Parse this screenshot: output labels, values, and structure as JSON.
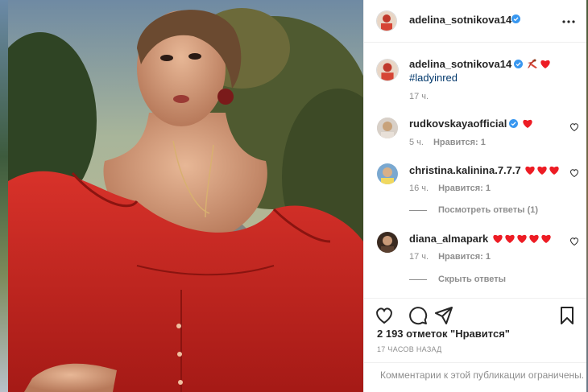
{
  "post": {
    "author": "adelina_sotnikova14",
    "caption_author": "adelina_sotnikova14",
    "caption_hashtag": "#ladyinred",
    "caption_time": "17 ч.",
    "likes_text": "2 193 отметок \"Нравится\"",
    "time_ago": "17 ЧАСОВ НАЗАД",
    "comments_limited": "Комментарии к этой публикации ограничены."
  },
  "comments": [
    {
      "user": "rudkovskayaofficial",
      "hearts": 1,
      "time": "5 ч.",
      "likes": "Нравится: 1"
    },
    {
      "user": "christina.kalinina.7.7.7",
      "hearts": 3,
      "time": "16 ч.",
      "likes": "Нравится: 1",
      "replies": "Посмотреть ответы (1)"
    },
    {
      "user": "diana_almapark",
      "hearts": 5,
      "time": "17 ч.",
      "likes": "Нравится: 1",
      "replies": "Скрыть ответы"
    }
  ],
  "icons": [
    "more-icon",
    "verified-badge-icon",
    "heart-icon",
    "comment-icon",
    "share-icon",
    "bookmark-icon",
    "heart-emoji-icon",
    "dancer-emoji-icon"
  ],
  "colors": {
    "verified": "#3897f0",
    "heart_emoji": "#ed1c24",
    "link": "#00376b",
    "muted": "#8e8e8e",
    "text": "#262626"
  }
}
